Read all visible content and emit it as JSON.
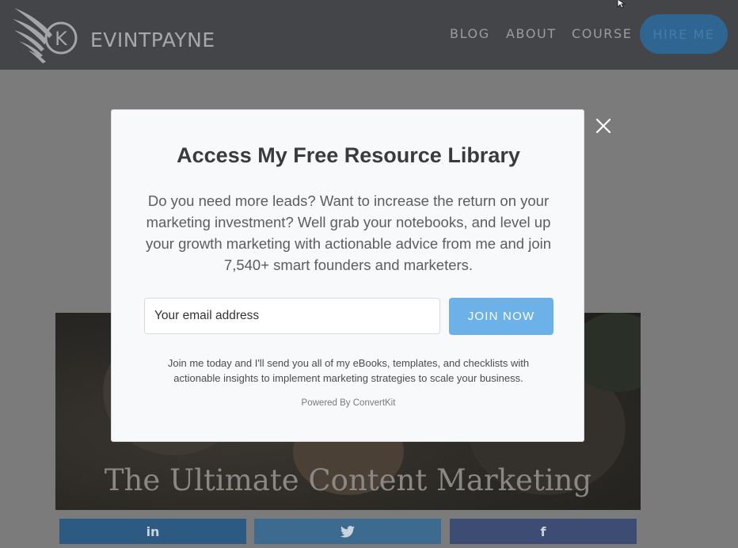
{
  "header": {
    "logo_text": "EVINTPAYNE",
    "logo_letter": "K",
    "nav": [
      {
        "label": "BLOG"
      },
      {
        "label": "ABOUT"
      },
      {
        "label": "COURSE"
      }
    ],
    "cta_label": "HIRE ME"
  },
  "hero": {
    "title": "The Ultimate Content Marketing"
  },
  "share": {
    "linkedin_glyph": "in",
    "facebook_glyph": "f"
  },
  "modal": {
    "title": "Access My Free Resource Library",
    "description": "Do you need more leads? Want to increase the return on your marketing investment? Well grab your notebooks, and level up your growth marketing with actionable advice from me and join 7,540+ smart founders and marketers.",
    "email_placeholder": "Your email address",
    "join_label": "JOIN NOW",
    "note": "Join me today and I'll send you all of my eBooks, templates, and checklists with actionable insights to implement marketing strategies to scale your business.",
    "powered_by": "Powered By ConvertKit"
  },
  "icons": {
    "close": "close-icon",
    "linkedin": "linkedin-icon",
    "twitter": "twitter-icon",
    "facebook": "facebook-icon"
  },
  "colors": {
    "header_bg": "#444548",
    "join_button": "#6cb2e8",
    "hire_button": "#2e6591",
    "linkedin": "#2d5a82",
    "twitter": "#3d6b8f",
    "facebook": "#3d4c72"
  }
}
